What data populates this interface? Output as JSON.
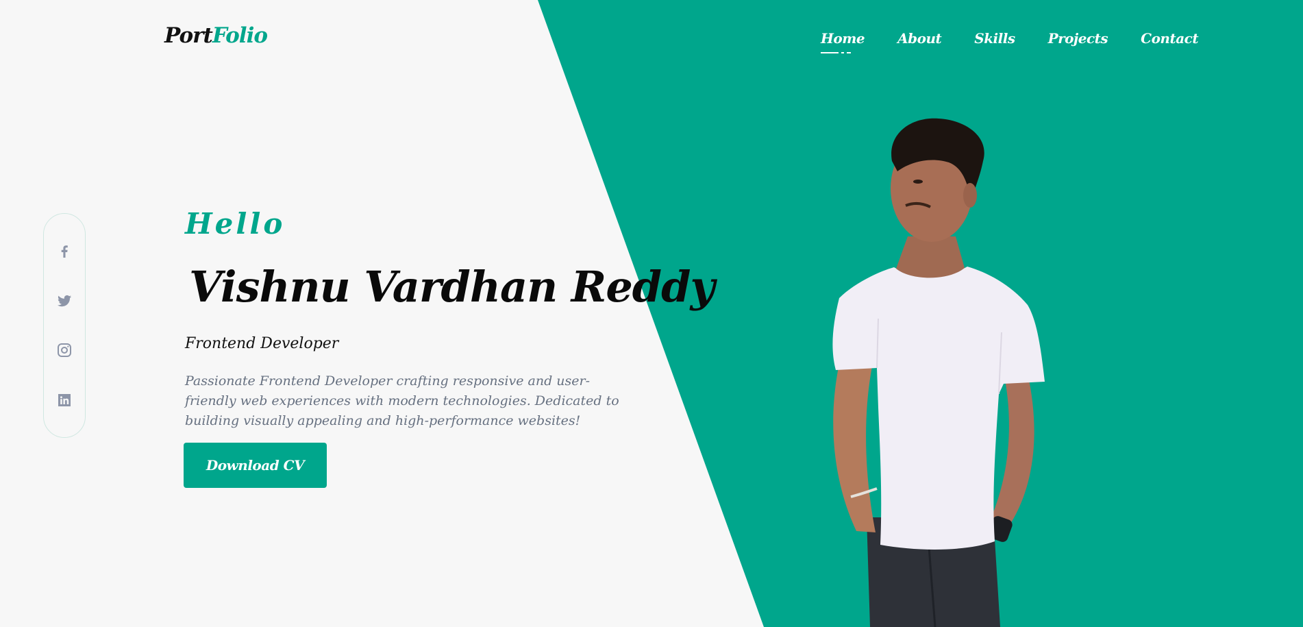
{
  "header": {
    "logo_part1": "Port",
    "logo_part2": "Folio"
  },
  "nav": {
    "items": [
      {
        "label": "Home",
        "active": true
      },
      {
        "label": "About"
      },
      {
        "label": "Skills"
      },
      {
        "label": "Projects"
      },
      {
        "label": "Contact"
      }
    ]
  },
  "social": {
    "icons": [
      "facebook-icon",
      "twitter-icon",
      "instagram-icon",
      "linkedin-icon"
    ]
  },
  "hero": {
    "greeting": "Hello",
    "name": "Vishnu Vardhan Reddy",
    "role": "Frontend Developer",
    "description": "Passionate Frontend Developer crafting responsive and user-friendly web experiences with modern technologies. Dedicated to building visually appealing and high-performance websites!",
    "cta_label": "Download CV"
  },
  "colors": {
    "accent": "#00a68c",
    "background": "#f7f7f7",
    "text_dark": "#0a0a0a",
    "text_muted": "#667080"
  }
}
